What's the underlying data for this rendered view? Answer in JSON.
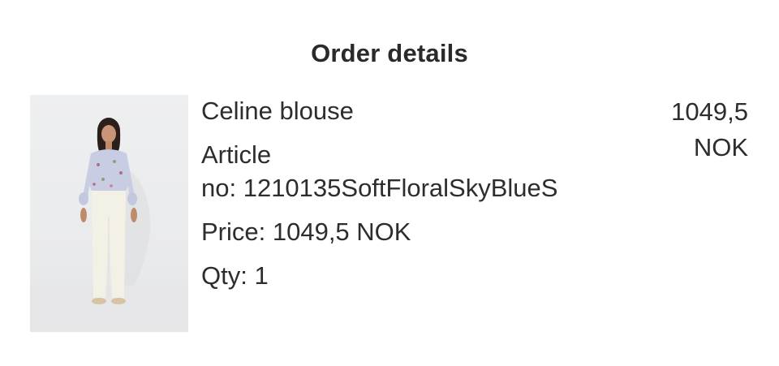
{
  "header": {
    "title": "Order details"
  },
  "item": {
    "name": "Celine blouse",
    "article_line1": "Article",
    "article_line2": "no: 1210135SoftFloralSkyBlueS",
    "price": "Price: 1049,5 NOK",
    "qty": "Qty: 1",
    "total_amount": "1049,5",
    "total_currency": "NOK"
  },
  "image": {
    "subject": "product-photo-model"
  }
}
